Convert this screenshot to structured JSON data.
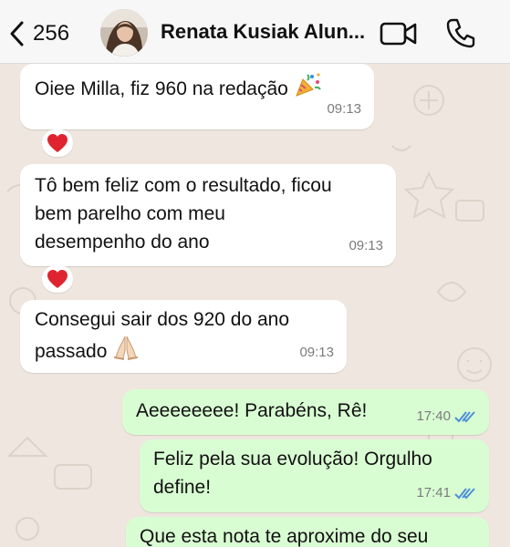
{
  "header": {
    "back_count": "256",
    "contact_name": "Renata Kusiak Alun..."
  },
  "icons": {
    "back": "chevron-left-icon",
    "video": "video-camera-icon",
    "call": "phone-icon",
    "party": "party-popper-icon",
    "heart": "red-heart-icon",
    "praying": "praying-hands-icon",
    "read": "double-check-icon"
  },
  "colors": {
    "incoming_bubble": "#ffffff",
    "outgoing_bubble": "#d9fdd3",
    "read_ticks": "#4f8fd6",
    "heart": "#e0242f"
  },
  "messages": [
    {
      "direction": "in",
      "lines": [
        "Oiee Milla, fiz 960 na redação"
      ],
      "time": "09:13",
      "reaction": "❤️"
    },
    {
      "direction": "in",
      "lines": [
        "Tô bem feliz com o resultado, ficou",
        "bem parelho com meu",
        "desempenho do ano"
      ],
      "time": "09:13",
      "reaction": "❤️"
    },
    {
      "direction": "in",
      "lines": [
        "Consegui sair dos 920 do ano",
        "passado"
      ],
      "time": "09:13"
    },
    {
      "direction": "out",
      "lines": [
        "Aeeeeeeee! Parabéns, Rê!"
      ],
      "time": "17:40",
      "status": "read"
    },
    {
      "direction": "out",
      "lines": [
        "Feliz pela sua evolução! Orgulho",
        "define!"
      ],
      "time": "17:41",
      "status": "read"
    },
    {
      "direction": "out",
      "lines": [
        "Que esta nota te aproxime do seu"
      ]
    }
  ]
}
